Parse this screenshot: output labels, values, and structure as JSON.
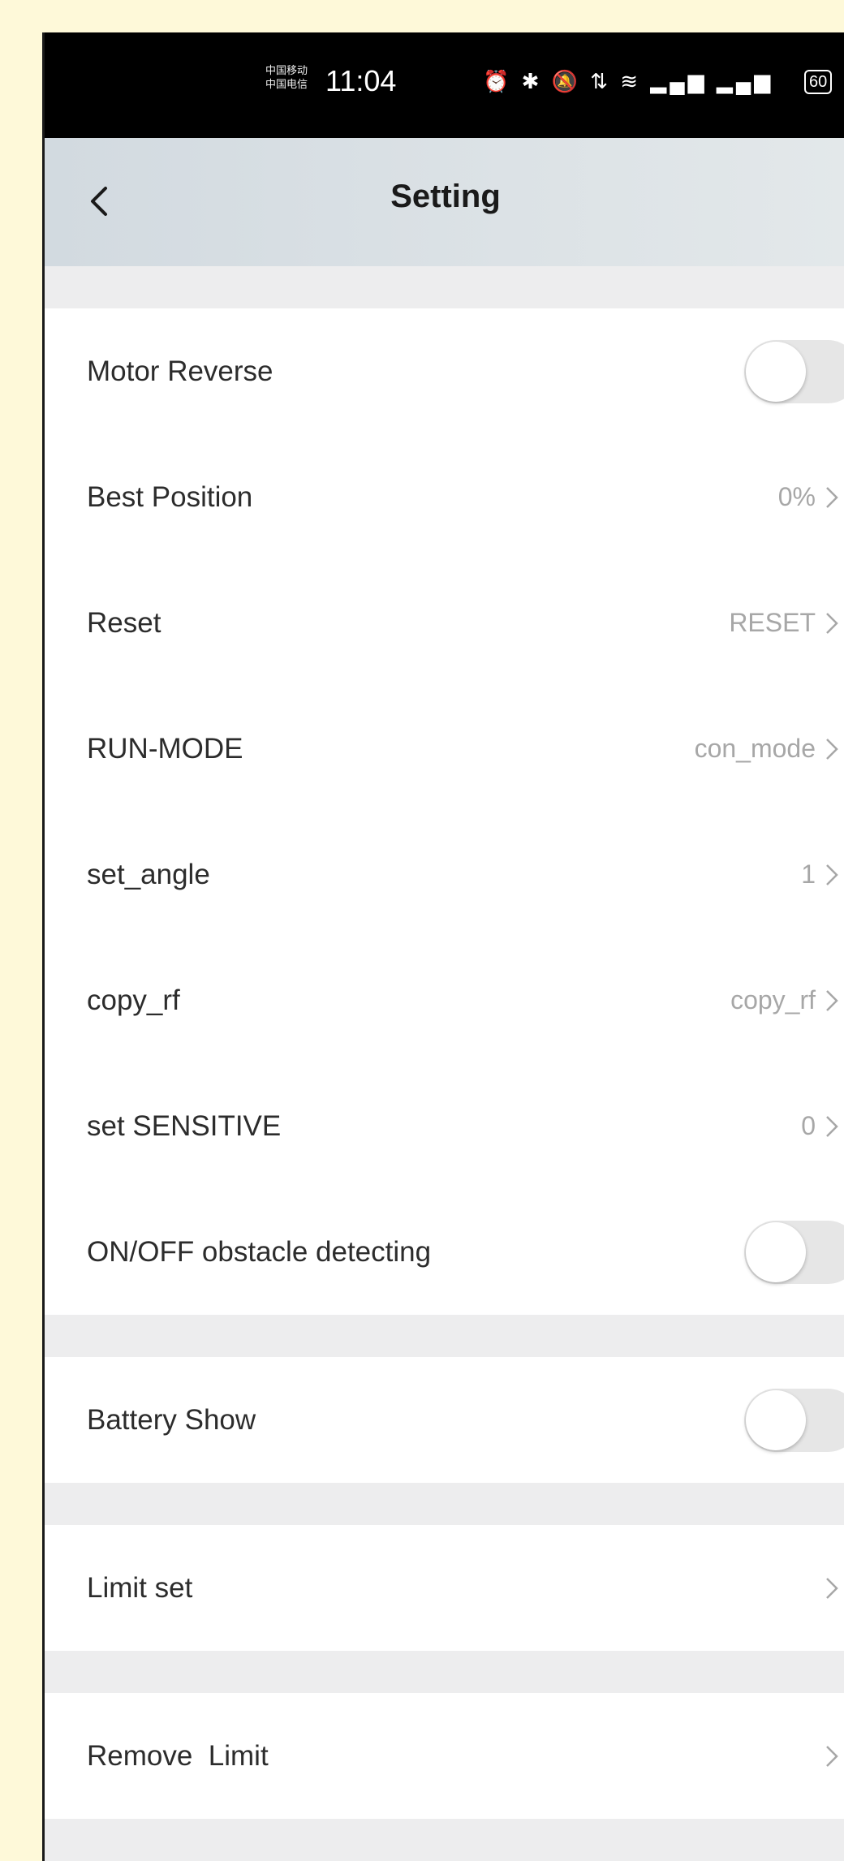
{
  "status_bar": {
    "carrier_line1": "中国移动",
    "carrier_line2": "中国电信",
    "time": "11:04",
    "icons": "⏰ ✱ 🔕 ⇅ ≋ ▂▄▆ ▂▄▆",
    "battery": "60"
  },
  "header": {
    "title": "Setting",
    "back_icon": "chevron-left-icon"
  },
  "settings": {
    "motor_reverse": {
      "label": "Motor Reverse",
      "on": false
    },
    "best_position": {
      "label": "Best Position",
      "value": "0%"
    },
    "reset": {
      "label": "Reset",
      "value": "RESET"
    },
    "run_mode": {
      "label": "RUN-MODE",
      "value": "con_mode"
    },
    "set_angle": {
      "label": "set_angle",
      "value": "1"
    },
    "copy_rf": {
      "label": "copy_rf",
      "value": "copy_rf"
    },
    "set_sensitive": {
      "label": "set SENSITIVE",
      "value": "0"
    },
    "obstacle": {
      "label": "ON/OFF obstacle detecting",
      "on": false
    },
    "battery_show": {
      "label": "Battery Show",
      "on": false
    },
    "limit_set": {
      "label": "Limit set"
    },
    "remove_limit": {
      "label": "Remove  Limit"
    }
  },
  "colors": {
    "background": "#fef9d9",
    "page": "#ededee",
    "value_text": "#a7a7a7"
  }
}
